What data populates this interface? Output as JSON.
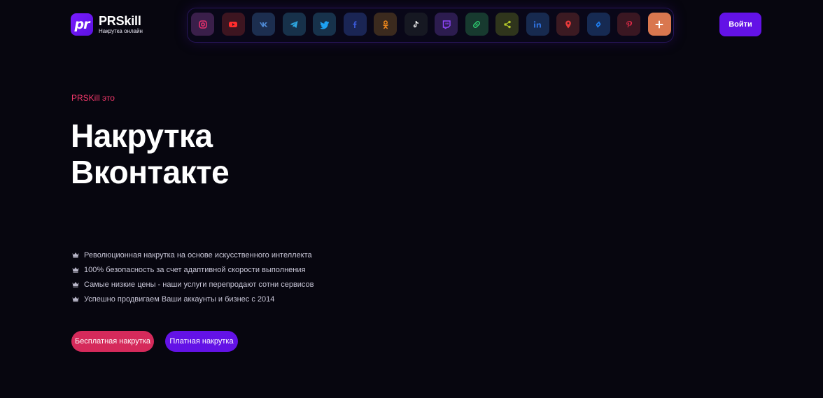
{
  "header": {
    "logo_mark": "pr",
    "logo_name": "PRSkill",
    "logo_tagline": "Накрутка онлайн",
    "login_label": "Войти"
  },
  "socials": [
    {
      "name": "instagram-icon",
      "bg": "#3a1f4a",
      "fg": "#e1306c"
    },
    {
      "name": "youtube-icon",
      "bg": "#3d1520",
      "fg": "#ff2d2d"
    },
    {
      "name": "vk-icon",
      "bg": "#1c2e4f",
      "fg": "#4f8bd6"
    },
    {
      "name": "telegram-icon",
      "bg": "#17314a",
      "fg": "#2ea6df"
    },
    {
      "name": "twitter-icon",
      "bg": "#17324b",
      "fg": "#1da1f2"
    },
    {
      "name": "facebook-icon",
      "bg": "#1a2554",
      "fg": "#3b5bdb"
    },
    {
      "name": "odnoklassniki-icon",
      "bg": "#3b2a1e",
      "fg": "#f28a1c"
    },
    {
      "name": "tiktok-icon",
      "bg": "#161822",
      "fg": "#ffffff"
    },
    {
      "name": "twitch-icon",
      "bg": "#2c1c4f",
      "fg": "#9147ff"
    },
    {
      "name": "link-icon",
      "bg": "#173a2f",
      "fg": "#2ecc71"
    },
    {
      "name": "share-icon",
      "bg": "#2f351c",
      "fg": "#b5c92a"
    },
    {
      "name": "linkedin-icon",
      "bg": "#172a4f",
      "fg": "#2f6fd8"
    },
    {
      "name": "map-pin-icon",
      "bg": "#3b1a22",
      "fg": "#e83a3a"
    },
    {
      "name": "shazam-icon",
      "bg": "#162a52",
      "fg": "#1f7ef0"
    },
    {
      "name": "pinterest-icon",
      "bg": "#3a1722",
      "fg": "#e02a48"
    },
    {
      "name": "plus-icon",
      "bg": "#d9774f",
      "fg": "#ffffff"
    }
  ],
  "hero": {
    "eyebrow": "PRSKill это",
    "title_line1": "Накрутка",
    "title_line2": "Вконтакте",
    "features": [
      "Революционная накрутка на основе искусственного интеллекта",
      "100% безопасность за счет адаптивной скорости выполнения",
      "Самые низкие цены - наши услуги перепродают сотни сервисов",
      "Успешно продвигаем Ваши аккаунты и бизнес с 2014"
    ],
    "btn_free": "Бесплатная накрутка",
    "btn_paid": "Платная накрутка"
  },
  "colors": {
    "background": "#07060f",
    "accent_purple": "#6312e6",
    "accent_pink": "#d52a5b",
    "eyebrow_pink": "#f0386a"
  }
}
